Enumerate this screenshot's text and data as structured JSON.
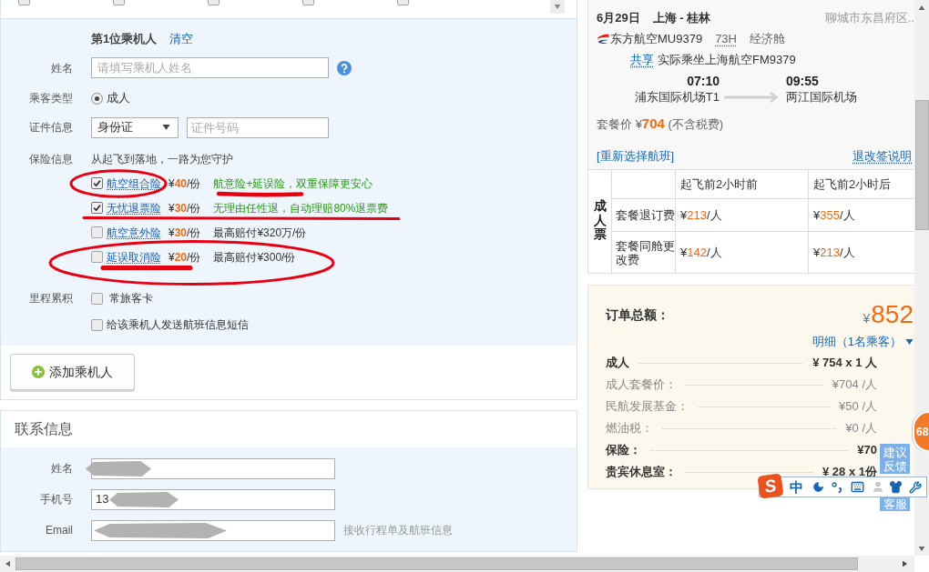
{
  "passenger_picker": {
    "passengers": [
      {
        "checked": false
      },
      {
        "checked": false
      },
      {
        "checked": false
      },
      {
        "checked": false
      },
      {
        "checked": false
      }
    ]
  },
  "passenger": {
    "title": "第1位乘机人",
    "clear": "清空",
    "name": {
      "label": "姓名",
      "placeholder": "请填写乘机人姓名"
    },
    "type": {
      "label": "乘客类型",
      "options": [
        {
          "label": "成人",
          "selected": true
        }
      ]
    },
    "document": {
      "label": "证件信息",
      "type": "身份证",
      "placeholder": "证件号码"
    },
    "insurance": {
      "label": "保险信息",
      "intro": "从起飞到落地，一路为您守护",
      "items": [
        {
          "name": "航空组合险",
          "currency": "¥",
          "amount": "40",
          "unit": "/份",
          "checked": true,
          "note": "航意险+延误险，双重保障更安心",
          "highlight": true
        },
        {
          "name": "无忧退票险",
          "currency": "¥",
          "amount": "30",
          "unit": "/份",
          "checked": true,
          "note": "无理由任性退，自动理赔80%退票费",
          "highlight": true
        },
        {
          "name": "航空意外险",
          "currency": "¥",
          "amount": "30",
          "unit": "/份",
          "checked": false,
          "note": "最高赔付¥320万/份",
          "highlight": false
        },
        {
          "name": "延误取消险",
          "currency": "¥",
          "amount": "20",
          "unit": "/份",
          "checked": false,
          "note": "最高赔付¥300/份",
          "highlight": false
        }
      ]
    },
    "mileage": {
      "label": "里程累积",
      "option": {
        "label": "常旅客卡",
        "checked": false
      }
    },
    "sms": {
      "label": "给该乘机人发送航班信息短信",
      "checked": false
    }
  },
  "add_passenger": "添加乘机人",
  "contact": {
    "title": "联系信息",
    "fields": [
      {
        "label": "姓名",
        "redacted": true
      },
      {
        "label": "手机号",
        "value": "13",
        "redacted": true
      },
      {
        "label": "Email",
        "redacted": true,
        "hint": "接收行程单及航班信息"
      }
    ]
  },
  "flight": {
    "date": "6月29日",
    "route": "上海 - 桂林",
    "location": "聊城市东昌府区..",
    "airline": "东方航空MU9379",
    "aircraft": "73H",
    "cabin": "经济舱",
    "share_tag": "共享",
    "operated_by": "实际乘坐上海航空FM9379",
    "depart": {
      "time": "07:10",
      "airport": "浦东国际机场T1"
    },
    "arrive": {
      "time": "09:55",
      "airport": "两江国际机场"
    },
    "price_label": "套餐价",
    "price_currency": "¥",
    "price": "704",
    "price_note": "(不含税费)",
    "reselect": "[重新选择航班]",
    "rules": "退改签说明"
  },
  "fee_table": {
    "group": "成人票",
    "columns": [
      "起飞前2小时前",
      "起飞前2小时后"
    ],
    "rows": [
      {
        "label": "套餐退订费",
        "cells": [
          {
            "currency": "¥",
            "amount": "213",
            "unit": "/人"
          },
          {
            "currency": "¥",
            "amount": "355",
            "unit": "/人"
          }
        ]
      },
      {
        "label": "套餐同舱更改费",
        "cells": [
          {
            "currency": "¥",
            "amount": "142",
            "unit": "/人"
          },
          {
            "currency": "¥",
            "amount": "213",
            "unit": "/人"
          }
        ]
      }
    ]
  },
  "order": {
    "title": "订单总额：",
    "currency": "¥",
    "total": "852",
    "details_toggle": "明细（1名乘客）",
    "lines": [
      {
        "label": "成人",
        "value": "¥ 754 x 1 人",
        "bold": true
      },
      {
        "label": "成人套餐价：",
        "value": "¥704 /人",
        "bold": false
      },
      {
        "label": "民航发展基金：",
        "value": "¥50 /人",
        "bold": false
      },
      {
        "label": "燃油税：",
        "value": "¥0 /人",
        "bold": false
      },
      {
        "label": "保险：",
        "value": "¥70",
        "bold": true
      },
      {
        "label": "贵宾休息室：",
        "value": "¥ 28 x 1份",
        "bold": true
      }
    ]
  },
  "side_widgets": {
    "badge": "68",
    "feedback": "建议反馈",
    "service": "客服"
  },
  "ime_toolbar": {
    "logo": "S",
    "mode": "中"
  }
}
